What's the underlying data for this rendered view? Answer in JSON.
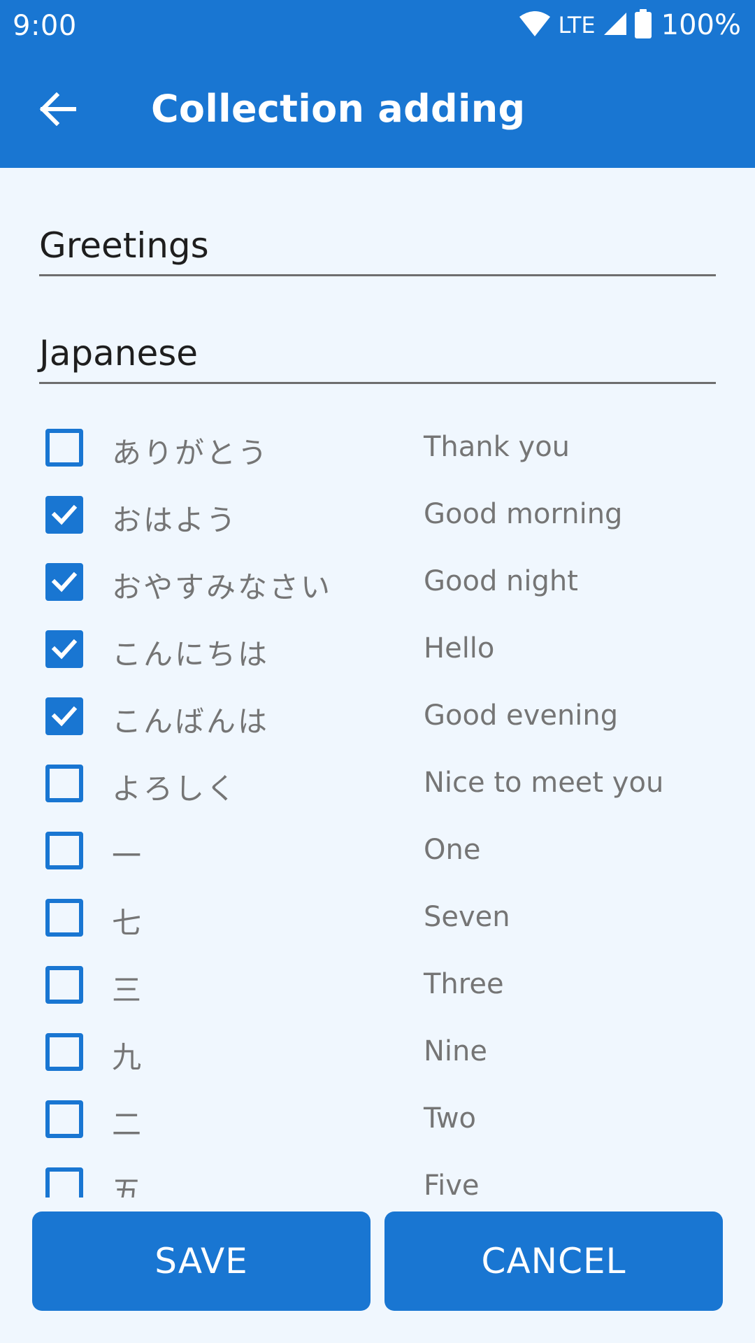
{
  "status_bar": {
    "time": "9:00",
    "network": "LTE",
    "battery": "100%",
    "icons": [
      "wifi-icon",
      "signal-icon",
      "battery-icon"
    ]
  },
  "app_bar": {
    "back_icon": "arrow-back-icon",
    "title": "Collection adding"
  },
  "form": {
    "collection_name": "Greetings",
    "language": "Japanese"
  },
  "words": [
    {
      "jp": "ありがとう",
      "en": "Thank you",
      "checked": false
    },
    {
      "jp": "おはよう",
      "en": "Good morning",
      "checked": true
    },
    {
      "jp": "おやすみなさい",
      "en": "Good night",
      "checked": true
    },
    {
      "jp": "こんにちは",
      "en": "Hello",
      "checked": true
    },
    {
      "jp": "こんばんは",
      "en": "Good evening",
      "checked": true
    },
    {
      "jp": "よろしく",
      "en": "Nice to meet you",
      "checked": false
    },
    {
      "jp": "一",
      "en": "One",
      "checked": false
    },
    {
      "jp": "七",
      "en": "Seven",
      "checked": false
    },
    {
      "jp": "三",
      "en": "Three",
      "checked": false
    },
    {
      "jp": "九",
      "en": "Nine",
      "checked": false
    },
    {
      "jp": "二",
      "en": "Two",
      "checked": false
    },
    {
      "jp": "五",
      "en": "Five",
      "checked": false
    }
  ],
  "buttons": {
    "save": "SAVE",
    "cancel": "CANCEL"
  },
  "colors": {
    "primary": "#1976D2",
    "background": "#F0F7FE",
    "secondary_text": "#757575"
  }
}
